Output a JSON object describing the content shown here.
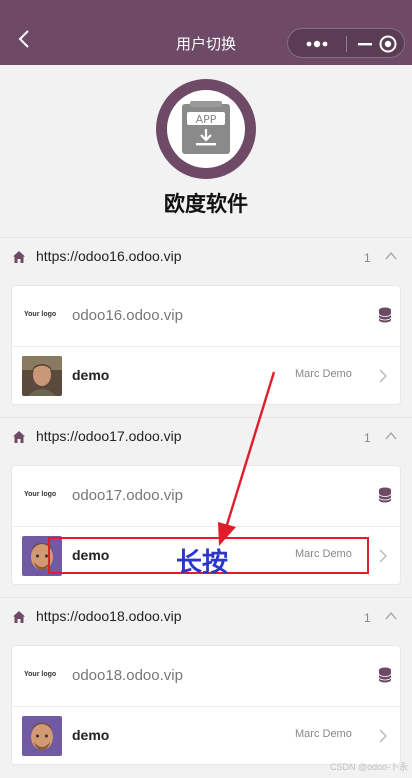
{
  "navbar": {
    "title": "用户切换",
    "back_icon": "chevron-left-icon",
    "more_icon": "more-dots-icon",
    "minimize_icon": "minus-icon",
    "close_icon": "target-circle-icon",
    "background": "#6e4a67"
  },
  "brand": {
    "logo_text": "APP",
    "app_name": "欧度软件"
  },
  "groups": [
    {
      "server_url": "https://odoo16.odoo.vip",
      "count": "1",
      "database": {
        "logo_text": "Your logo",
        "name": "odoo16.odoo.vip"
      },
      "user": {
        "login": "demo",
        "full_name": "Marc Demo"
      }
    },
    {
      "server_url": "https://odoo17.odoo.vip",
      "count": "1",
      "database": {
        "logo_text": "Your logo",
        "name": "odoo17.odoo.vip"
      },
      "user": {
        "login": "demo",
        "full_name": "Marc Demo"
      }
    },
    {
      "server_url": "https://odoo18.odoo.vip",
      "count": "1",
      "database": {
        "logo_text": "Your logo",
        "name": "odoo18.odoo.vip"
      },
      "user": {
        "login": "demo",
        "full_name": "Marc Demo"
      }
    }
  ],
  "annotation": {
    "label": "长按",
    "color": "#e11d2c",
    "label_color": "#2c37c9"
  },
  "watermark": "CSDN @odoo-卜永"
}
